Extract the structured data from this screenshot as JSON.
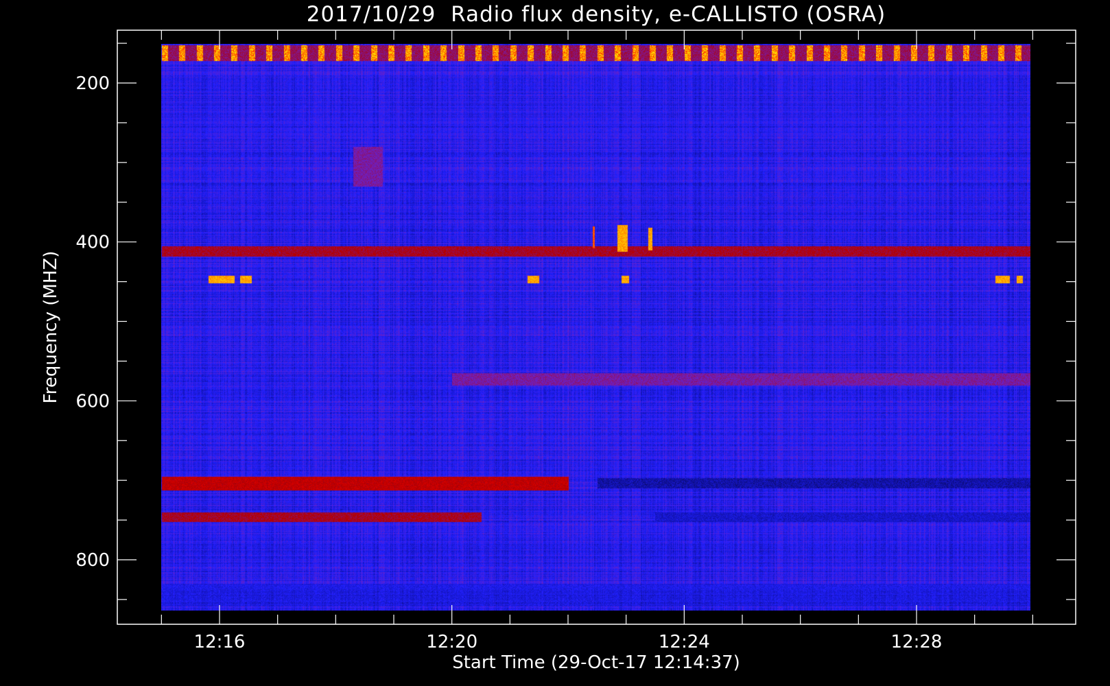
{
  "chart_data": {
    "type": "heatmap",
    "title": "2017/10/29  Radio flux density, e-CALLISTO (OSRA)",
    "xlabel": "Start Time (29-Oct-17 12:14:37)",
    "ylabel": "Frequency (MHZ)",
    "x_range_minutes": [
      "12:14:37",
      "12:30:00"
    ],
    "y_range_mhz": [
      150,
      870
    ],
    "y_inverted": true,
    "grid": false,
    "colormap": [
      "#000000",
      "#1010a0",
      "#2020ff",
      "#7020c0",
      "#b00000",
      "#ff0000",
      "#ff8000",
      "#ffff00"
    ],
    "background_color": "#0000ff",
    "x_ticks": [
      {
        "label": "12:16",
        "minute": 16
      },
      {
        "label": "12:20",
        "minute": 20
      },
      {
        "label": "12:24",
        "minute": 24
      },
      {
        "label": "12:28",
        "minute": 28
      }
    ],
    "x_minor_minutes": [
      15,
      17,
      18,
      19,
      21,
      22,
      23,
      25,
      26,
      27,
      29,
      30
    ],
    "y_ticks": [
      {
        "label": "200",
        "mhz": 200
      },
      {
        "label": "400",
        "mhz": 400
      },
      {
        "label": "600",
        "mhz": 600
      },
      {
        "label": "800",
        "mhz": 800
      }
    ],
    "y_minor_mhz": [
      150,
      250,
      300,
      350,
      450,
      500,
      550,
      650,
      700,
      750,
      850
    ],
    "features": [
      {
        "kind": "band",
        "f0": 152,
        "f1": 172,
        "t0": 15.0,
        "t1": 30.0,
        "level": 0.75,
        "periodic_burst_min": 0.3
      },
      {
        "kind": "band",
        "f0": 405,
        "f1": 418,
        "t0": 15.0,
        "t1": 30.0,
        "level": 0.55
      },
      {
        "kind": "burst",
        "f0": 442,
        "f1": 452,
        "t0": 15.8,
        "t1": 16.25,
        "level": 0.9
      },
      {
        "kind": "burst",
        "f0": 442,
        "f1": 452,
        "t0": 16.35,
        "t1": 16.55,
        "level": 0.9
      },
      {
        "kind": "burst",
        "f0": 442,
        "f1": 452,
        "t0": 21.3,
        "t1": 21.5,
        "level": 0.9
      },
      {
        "kind": "burst",
        "f0": 442,
        "f1": 452,
        "t0": 22.92,
        "t1": 23.05,
        "level": 0.9
      },
      {
        "kind": "burst",
        "f0": 442,
        "f1": 452,
        "t0": 29.35,
        "t1": 29.6,
        "level": 0.9
      },
      {
        "kind": "burst",
        "f0": 442,
        "f1": 452,
        "t0": 29.72,
        "t1": 29.82,
        "level": 0.9
      },
      {
        "kind": "burst",
        "f0": 378,
        "f1": 412,
        "t0": 22.85,
        "t1": 23.02,
        "level": 0.9
      },
      {
        "kind": "burst",
        "f0": 382,
        "f1": 410,
        "t0": 23.38,
        "t1": 23.45,
        "level": 0.9
      },
      {
        "kind": "burst",
        "f0": 380,
        "f1": 408,
        "t0": 22.42,
        "t1": 22.46,
        "level": 0.8
      },
      {
        "kind": "band",
        "f0": 695,
        "f1": 712,
        "t0": 15.0,
        "t1": 22.0,
        "level": 0.6
      },
      {
        "kind": "band",
        "f0": 740,
        "f1": 752,
        "t0": 15.0,
        "t1": 20.5,
        "level": 0.55
      },
      {
        "kind": "dark",
        "f0": 697,
        "f1": 710,
        "t0": 22.5,
        "t1": 30.0,
        "level": 0.1
      },
      {
        "kind": "dark",
        "f0": 740,
        "f1": 752,
        "t0": 23.5,
        "t1": 30.0,
        "level": 0.15
      },
      {
        "kind": "dark",
        "f0": 830,
        "f1": 858,
        "t0": 15.0,
        "t1": 30.0,
        "level": 0.2
      },
      {
        "kind": "dark",
        "f0": 220,
        "f1": 265,
        "t0": 15.0,
        "t1": 30.0,
        "level": 0.3
      },
      {
        "kind": "band",
        "f0": 280,
        "f1": 330,
        "t0": 18.3,
        "t1": 18.8,
        "level": 0.45
      },
      {
        "kind": "band",
        "f0": 565,
        "f1": 580,
        "t0": 20.0,
        "t1": 30.0,
        "level": 0.45
      }
    ]
  }
}
